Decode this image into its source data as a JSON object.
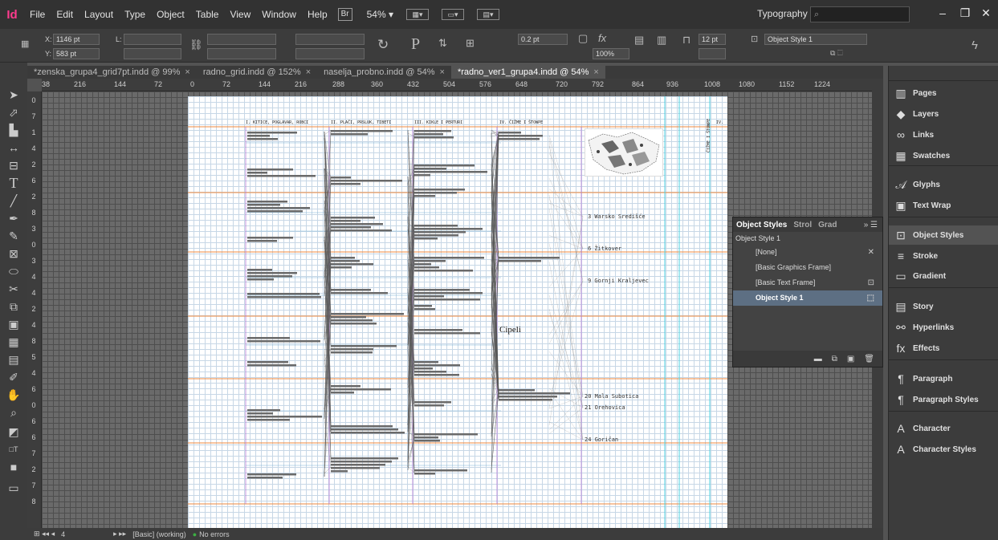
{
  "app": {
    "logo": "Id",
    "workspace": "Typography",
    "br_label": "Br",
    "zoom": "54%"
  },
  "menu": [
    "File",
    "Edit",
    "Layout",
    "Type",
    "Object",
    "Table",
    "View",
    "Window",
    "Help"
  ],
  "control": {
    "x_label": "X:",
    "x_value": "1146 pt",
    "y_label": "Y:",
    "y_value": "583 pt",
    "w_label": "L:",
    "stroke_weight": "0.2 pt",
    "scale": "100%",
    "gutter": "12 pt",
    "object_style": "Object Style 1"
  },
  "tabs": [
    {
      "label": "*zenska_grupa4_grid7pt.indd @ 99%",
      "active": false
    },
    {
      "label": "radno_grid.indd @ 152%",
      "active": false
    },
    {
      "label": "naselja_probno.indd @ 54%",
      "active": false
    },
    {
      "label": "*radno_ver1_grupa4.indd @ 54%",
      "active": true
    }
  ],
  "ruler_h": [
    "38",
    "216",
    "144",
    "72",
    "0",
    "72",
    "144",
    "216",
    "288",
    "360",
    "432",
    "504",
    "576",
    "648",
    "720",
    "792",
    "864",
    "936",
    "1008",
    "1080",
    "1152",
    "1224"
  ],
  "ruler_v": [
    "0",
    "7",
    "1",
    "4",
    "2",
    "6",
    "2",
    "8",
    "3",
    "0",
    "3",
    "4",
    "4",
    "2",
    "4",
    "8",
    "5",
    "4",
    "6",
    "0",
    "6",
    "6",
    "7",
    "2",
    "7",
    "8"
  ],
  "columns": [
    {
      "title": "I. KITICE, POGLAVAR, ROBCI"
    },
    {
      "title": "II. PLAČI, PRSLUK, TIBETI"
    },
    {
      "title": "III. KIKLE I PERTURI"
    },
    {
      "title": "IV. ČIŽME I ŠTOWPE"
    },
    {
      "title": "IV."
    }
  ],
  "vertical_title": "ČIŽME I ŠTOWPE",
  "towns": [
    "3 Warsko Središće",
    "6 Žitkover",
    "9 Gornji Kraljevec",
    "20 Mala Subotica",
    "21 Orehovica",
    "24 Goričan"
  ],
  "annotation": "Cipeli",
  "object_styles": {
    "tabs": [
      "Object Styles",
      "Strol",
      "Grad"
    ],
    "current": "Object Style 1",
    "items": [
      {
        "label": "[None]",
        "selected": false
      },
      {
        "label": "[Basic Graphics Frame]",
        "selected": false
      },
      {
        "label": "[Basic Text Frame]",
        "selected": false
      },
      {
        "label": "Object Style 1",
        "selected": true
      }
    ]
  },
  "dock": [
    "Pages",
    "Layers",
    "Links",
    "Swatches",
    "Glyphs",
    "Text Wrap",
    "Object Styles",
    "Stroke",
    "Gradient",
    "Story",
    "Hyperlinks",
    "Effects",
    "Paragraph",
    "Paragraph Styles",
    "Character",
    "Character Styles"
  ],
  "status": {
    "page": "4",
    "style": "[Basic] (working)",
    "errors": "No errors"
  }
}
